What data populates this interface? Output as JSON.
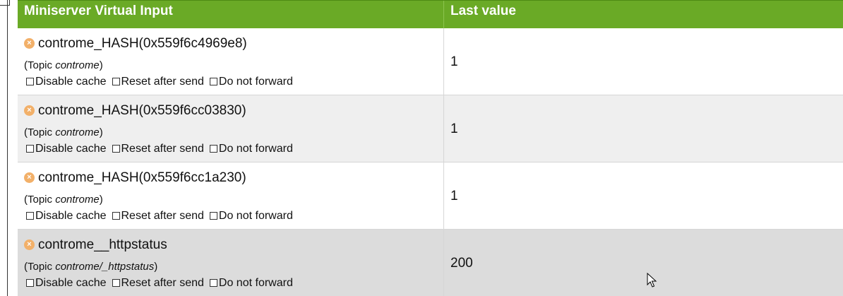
{
  "table": {
    "header": {
      "col1": "Miniserver Virtual Input",
      "col2": "Last value"
    },
    "rows": [
      {
        "name": "controme_HASH(0x559f6c4969e8)",
        "topic_prefix": "(Topic ",
        "topic": "controme",
        "topic_suffix": ")",
        "options": [
          "Disable cache",
          "Reset after send",
          "Do not forward"
        ],
        "value": "1",
        "bg": "#ffffff"
      },
      {
        "name": "controme_HASH(0x559f6cc03830)",
        "topic_prefix": "(Topic ",
        "topic": "controme",
        "topic_suffix": ")",
        "options": [
          "Disable cache",
          "Reset after send",
          "Do not forward"
        ],
        "value": "1",
        "bg": "#efefef"
      },
      {
        "name": "controme_HASH(0x559f6cc1a230)",
        "topic_prefix": "(Topic ",
        "topic": "controme",
        "topic_suffix": ")",
        "options": [
          "Disable cache",
          "Reset after send",
          "Do not forward"
        ],
        "value": "1",
        "bg": "#ffffff"
      },
      {
        "name": "controme__httpstatus",
        "topic_prefix": "(Topic ",
        "topic": "controme/_httpstatus",
        "topic_suffix": ")",
        "options": [
          "Disable cache",
          "Reset after send",
          "Do not forward"
        ],
        "value": "200",
        "bg": "#dcdcdc"
      }
    ]
  },
  "colors": {
    "header_bg": "#6aaa26",
    "remove_icon": "#f2b069"
  },
  "icons": {
    "remove": "x-circle-icon",
    "cursor": "mouse-pointer-icon"
  }
}
